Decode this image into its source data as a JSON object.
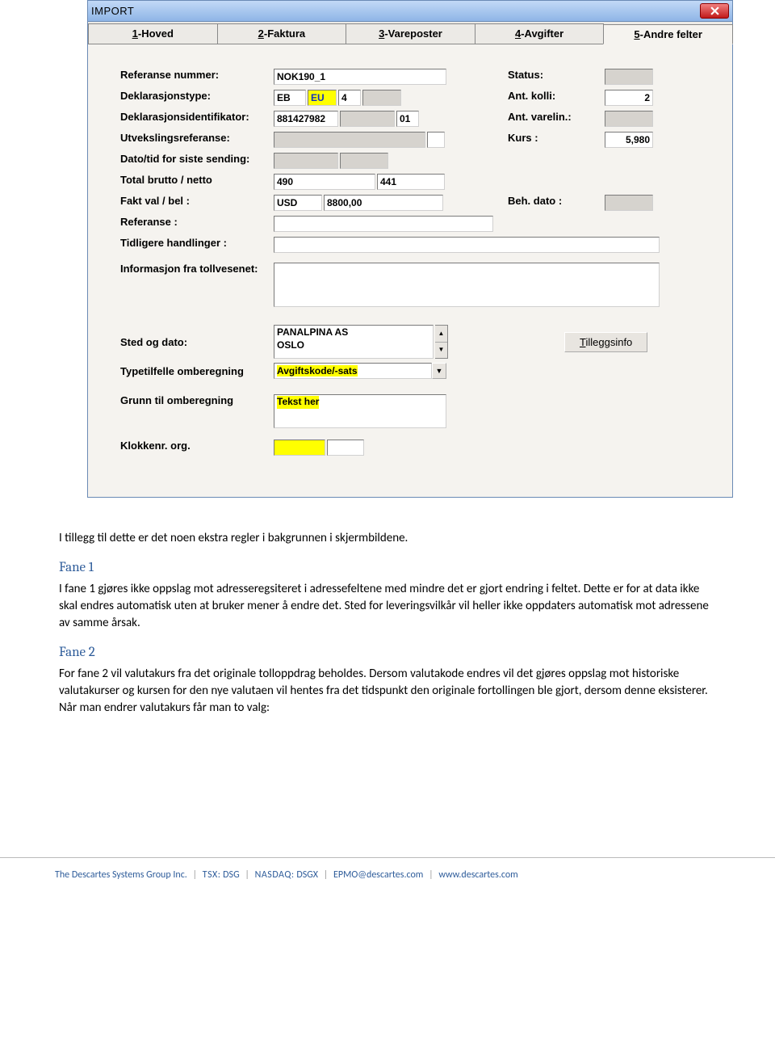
{
  "window": {
    "title": "IMPORT",
    "tabs": [
      "1-Hoved",
      "2-Faktura",
      "3-Vareposter",
      "4-Avgifter",
      "5-Andre felter"
    ],
    "active_tab": 4
  },
  "labels": {
    "ref_num": "Referanse nummer:",
    "decl_type": "Deklarasjonstype:",
    "decl_id": "Deklarasjonsidentifikator:",
    "exch_ref": "Utvekslingsreferanse:",
    "date_last_send": "Dato/tid for siste sending:",
    "total_bn": "Total brutto / netto",
    "fakt_val": "Fakt val / bel :",
    "referanse": "Referanse :",
    "tidligere": "Tidligere handlinger :",
    "info_toll": "Informasjon fra tollvesenet:",
    "sted_dato": "Sted og dato:",
    "type_omb": "Typetilfelle omberegning",
    "grunn_omb": "Grunn til omberegning",
    "klokke": "Klokkenr. org.",
    "status": "Status:",
    "ant_kolli": "Ant. kolli:",
    "ant_varelin": "Ant. varelin.:",
    "kurs": "Kurs :",
    "beh_dato": "Beh. dato :",
    "tilleggsinfo": "Tilleggsinfo"
  },
  "values": {
    "ref_num": "NOK190_1",
    "decl_type_1": "EB",
    "decl_type_2": "EU",
    "decl_type_3": "4",
    "decl_id_1": "881427982",
    "decl_id_2": "",
    "decl_id_3": "01",
    "brutto": "490",
    "netto": "441",
    "fakt_val": "USD",
    "fakt_bel": "8800,00",
    "ant_kolli": "2",
    "kurs": "5,980",
    "sted_dato": "PANALPINA AS\nOSLO",
    "type_omb": "Avgiftskode/-sats",
    "grunn_omb": "Tekst her",
    "klokke": ""
  },
  "article": {
    "p1": "I tillegg til dette er det noen ekstra regler i bakgrunnen i skjermbildene.",
    "h1": "Fane 1",
    "p2": "I fane 1 gjøres ikke oppslag mot adresseregsiteret i adressefeltene med mindre det er gjort endring i feltet. Dette er for at data ikke skal endres automatisk uten at bruker mener å endre det. Sted for leveringsvilkår vil heller ikke oppdaters automatisk mot adressene av samme årsak.",
    "h2": "Fane 2",
    "p3": "For fane 2 vil valutakurs fra det originale tolloppdrag beholdes. Dersom valutakode endres vil det gjøres oppslag mot historiske valutakurser og kursen for den nye valutaen vil hentes fra det tidspunkt den originale fortollingen ble gjort, dersom denne eksisterer. Når man endrer valutakurs får man to valg:"
  },
  "footer": {
    "company": "The Descartes Systems Group Inc.",
    "tsx_label": "TSX:",
    "tsx": "DSG",
    "nasdaq_label": "NASDAQ:",
    "nasdaq": "DSGX",
    "email": "EPMO@descartes.com",
    "url": "www.descartes.com"
  }
}
